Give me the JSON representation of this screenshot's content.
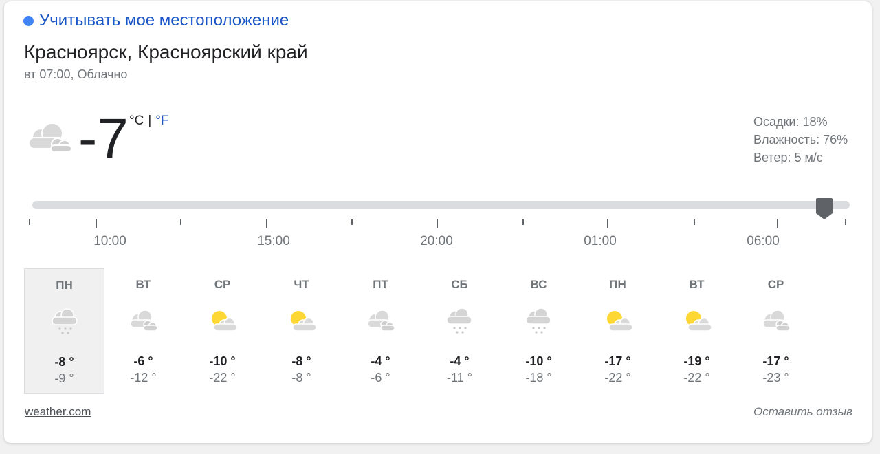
{
  "location_link": "Учитывать мое местоположение",
  "city": "Красноярск, Красноярский край",
  "subtitle": "вт 07:00, Облачно",
  "current": {
    "temp": "-7",
    "unit_c": "°C",
    "unit_sep": "|",
    "unit_f": "°F",
    "icon": "cloudy-icon"
  },
  "details": {
    "precip": "Осадки: 18%",
    "humidity": "Влажность: 76%",
    "wind": "Ветер: 5 м/с"
  },
  "timeline": {
    "labels": [
      "10:00",
      "15:00",
      "20:00",
      "01:00",
      "06:00"
    ],
    "position_fraction": 0.97
  },
  "days": [
    {
      "name": "ПН",
      "icon": "snow-icon",
      "hi": "-8 °",
      "lo": "-9 °",
      "selected": true
    },
    {
      "name": "ВТ",
      "icon": "cloudy-icon",
      "hi": "-6 °",
      "lo": "-12 °"
    },
    {
      "name": "СР",
      "icon": "partly-sunny-icon",
      "hi": "-10 °",
      "lo": "-22 °"
    },
    {
      "name": "ЧТ",
      "icon": "partly-sunny-icon",
      "hi": "-8 °",
      "lo": "-8 °"
    },
    {
      "name": "ПТ",
      "icon": "cloudy-icon",
      "hi": "-4 °",
      "lo": "-6 °"
    },
    {
      "name": "СБ",
      "icon": "snow-icon",
      "hi": "-4 °",
      "lo": "-11 °"
    },
    {
      "name": "ВС",
      "icon": "snow-icon",
      "hi": "-10 °",
      "lo": "-18 °"
    },
    {
      "name": "ПН",
      "icon": "partly-sunny-icon",
      "hi": "-17 °",
      "lo": "-22 °"
    },
    {
      "name": "ВТ",
      "icon": "partly-sunny-icon",
      "hi": "-19 °",
      "lo": "-22 °"
    },
    {
      "name": "СР",
      "icon": "cloudy-icon",
      "hi": "-17 °",
      "lo": "-23 °"
    }
  ],
  "footer": {
    "source": "weather.com",
    "feedback": "Оставить отзыв"
  },
  "colors": {
    "accent": "#1a57c6",
    "sun": "#fdd835",
    "cloud": "#d6d6d6"
  }
}
